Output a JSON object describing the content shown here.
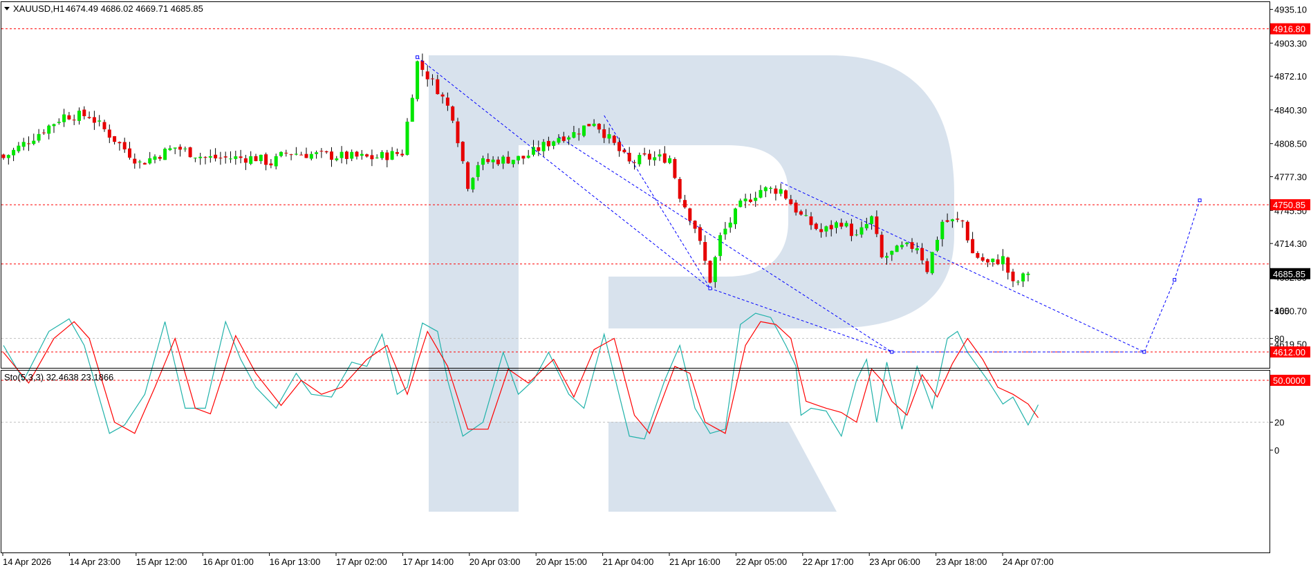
{
  "header": {
    "symbol_label": "XAUUSD,H1",
    "ohlc_label": "4674.49 4686.02 4669.71 4685.85"
  },
  "indicator": {
    "label": "Sto(5,3,3) 32.4638 23.1866",
    "main_color": "#20b2aa",
    "signal_color": "#ff0000"
  },
  "colors": {
    "bull": "#00e600",
    "bear": "#e60000",
    "level_line": "#ff0000",
    "forecast_line": "#0000ff",
    "watermark": "#d6e0ec"
  },
  "chart_data": [
    {
      "type": "candlestick",
      "symbol": "XAUUSD",
      "timeframe": "H1",
      "ylim": [
        4597,
        4942
      ],
      "y_ticks": [
        4935.1,
        4903.3,
        4872.1,
        4840.3,
        4808.5,
        4777.3,
        4745.5,
        4714.3,
        4682.5,
        4650.7,
        4619.5
      ],
      "y_tick_labels": [
        "4935.10",
        "4903.30",
        "4872.10",
        "4840.30",
        "4808.50",
        "4777.30",
        "4745.50",
        "4714.30",
        "4682.50",
        "4650.70",
        "4619.50"
      ],
      "x_labels": [
        "14 Apr 2026",
        "14 Apr 23:00",
        "15 Apr 12:00",
        "16 Apr 01:00",
        "16 Apr 13:00",
        "17 Apr 02:00",
        "17 Apr 14:00",
        "20 Apr 03:00",
        "20 Apr 15:00",
        "21 Apr 04:00",
        "21 Apr 16:00",
        "22 Apr 05:00",
        "22 Apr 17:00",
        "23 Apr 06:00",
        "23 Apr 18:00",
        "24 Apr 07:00"
      ],
      "levels": [
        {
          "value": 4916.8,
          "label": "4916.80"
        },
        {
          "value": 4750.85,
          "label": "4750.85"
        },
        {
          "value": 4695,
          "label": ""
        },
        {
          "value": 4612.0,
          "label": "4612.00"
        }
      ],
      "current_price": {
        "value": 4685.85,
        "label": "4685.85"
      },
      "key_closes": [
        {
          "bar": 0,
          "close": 4795
        },
        {
          "bar": 12,
          "close": 4835
        },
        {
          "bar": 17,
          "close": 4835
        },
        {
          "bar": 27,
          "close": 4790
        },
        {
          "bar": 34,
          "close": 4805
        },
        {
          "bar": 40,
          "close": 4795
        },
        {
          "bar": 50,
          "close": 4795
        },
        {
          "bar": 53,
          "close": 4790
        },
        {
          "bar": 56,
          "close": 4800
        },
        {
          "bar": 65,
          "close": 4797
        },
        {
          "bar": 73,
          "close": 4795
        },
        {
          "bar": 79,
          "close": 4800
        },
        {
          "bar": 82,
          "close": 4885
        },
        {
          "bar": 86,
          "close": 4860
        },
        {
          "bar": 89,
          "close": 4835
        },
        {
          "bar": 92,
          "close": 4770
        },
        {
          "bar": 94,
          "close": 4790
        },
        {
          "bar": 98,
          "close": 4793
        },
        {
          "bar": 103,
          "close": 4795
        },
        {
          "bar": 110,
          "close": 4815
        },
        {
          "bar": 113,
          "close": 4818
        },
        {
          "bar": 117,
          "close": 4830
        },
        {
          "bar": 124,
          "close": 4790
        },
        {
          "bar": 127,
          "close": 4795
        },
        {
          "bar": 132,
          "close": 4795
        },
        {
          "bar": 134,
          "close": 4760
        },
        {
          "bar": 137,
          "close": 4730
        },
        {
          "bar": 140,
          "close": 4680
        },
        {
          "bar": 142,
          "close": 4720
        },
        {
          "bar": 146,
          "close": 4750
        },
        {
          "bar": 150,
          "close": 4765
        },
        {
          "bar": 154,
          "close": 4765
        },
        {
          "bar": 158,
          "close": 4740
        },
        {
          "bar": 162,
          "close": 4725
        },
        {
          "bar": 166,
          "close": 4735
        },
        {
          "bar": 169,
          "close": 4720
        },
        {
          "bar": 172,
          "close": 4738
        },
        {
          "bar": 174,
          "close": 4700
        },
        {
          "bar": 178,
          "close": 4710
        },
        {
          "bar": 181,
          "close": 4712
        },
        {
          "bar": 183,
          "close": 4690
        },
        {
          "bar": 186,
          "close": 4735
        },
        {
          "bar": 190,
          "close": 4735
        },
        {
          "bar": 192,
          "close": 4705
        },
        {
          "bar": 195,
          "close": 4695
        },
        {
          "bar": 198,
          "close": 4700
        },
        {
          "bar": 200,
          "close": 4675
        },
        {
          "bar": 203,
          "close": 4685.85
        }
      ],
      "forecast_path": [
        {
          "bar": 82,
          "price": 4890
        },
        {
          "bar": 140,
          "price": 4672
        },
        {
          "bar": 176,
          "price": 4612
        },
        {
          "bar": 226,
          "price": 4612
        },
        {
          "bar": 232,
          "price": 4680
        },
        {
          "bar": 237,
          "price": 4755
        }
      ],
      "trend_lines": [
        {
          "from": {
            "bar": 110,
            "price": 4815
          },
          "to": {
            "bar": 176,
            "price": 4612
          }
        },
        {
          "from": {
            "bar": 119,
            "price": 4835
          },
          "to": {
            "bar": 140,
            "price": 4672
          }
        },
        {
          "from": {
            "bar": 154,
            "price": 4772
          },
          "to": {
            "bar": 226,
            "price": 4612
          }
        }
      ]
    },
    {
      "type": "line",
      "name": "Sto(5,3,3)",
      "ylim": [
        0,
        100
      ],
      "y_ticks": [
        100,
        80,
        20,
        0
      ],
      "y_tick_labels": [
        "100",
        "80",
        "20",
        "0"
      ],
      "levels": [
        {
          "value": 80,
          "label": ""
        },
        {
          "value": 50,
          "label": "50.0000"
        },
        {
          "value": 20,
          "label": ""
        }
      ],
      "series": [
        {
          "name": "main",
          "last": 32.4638,
          "key_points": [
            [
              0,
              75
            ],
            [
              4,
              50
            ],
            [
              9,
              85
            ],
            [
              13,
              94
            ],
            [
              16,
              75
            ],
            [
              21,
              12
            ],
            [
              24,
              18
            ],
            [
              28,
              40
            ],
            [
              32,
              92
            ],
            [
              36,
              30
            ],
            [
              40,
              30
            ],
            [
              44,
              92
            ],
            [
              47,
              65
            ],
            [
              50,
              45
            ],
            [
              54,
              30
            ],
            [
              58,
              55
            ],
            [
              61,
              40
            ],
            [
              65,
              38
            ],
            [
              69,
              63
            ],
            [
              72,
              60
            ],
            [
              75,
              83
            ],
            [
              78,
              40
            ],
            [
              80,
              45
            ],
            [
              83,
              91
            ],
            [
              86,
              85
            ],
            [
              88,
              50
            ],
            [
              91,
              10
            ],
            [
              95,
              20
            ],
            [
              99,
              70
            ],
            [
              102,
              40
            ],
            [
              105,
              50
            ],
            [
              108,
              70
            ],
            [
              112,
              40
            ],
            [
              115,
              30
            ],
            [
              119,
              83
            ],
            [
              124,
              10
            ],
            [
              127,
              8
            ],
            [
              131,
              50
            ],
            [
              134,
              75
            ],
            [
              137,
              30
            ],
            [
              140,
              12
            ],
            [
              143,
              15
            ],
            [
              146,
              90
            ],
            [
              149,
              98
            ],
            [
              152,
              95
            ],
            [
              155,
              75
            ],
            [
              157,
              60
            ],
            [
              158,
              25
            ],
            [
              160,
              30
            ],
            [
              163,
              28
            ],
            [
              166,
              10
            ],
            [
              169,
              50
            ],
            [
              171,
              65
            ],
            [
              173,
              20
            ],
            [
              175,
              63
            ],
            [
              178,
              15
            ],
            [
              181,
              60
            ],
            [
              184,
              30
            ],
            [
              187,
              80
            ],
            [
              189,
              85
            ],
            [
              191,
              70
            ],
            [
              195,
              50
            ],
            [
              198,
              33
            ],
            [
              200,
              38
            ],
            [
              203,
              18
            ],
            [
              205,
              32.4638
            ]
          ]
        },
        {
          "name": "signal",
          "last": 23.1866,
          "key_points": [
            [
              0,
              70
            ],
            [
              5,
              48
            ],
            [
              10,
              80
            ],
            [
              14,
              92
            ],
            [
              17,
              80
            ],
            [
              22,
              20
            ],
            [
              26,
              12
            ],
            [
              30,
              45
            ],
            [
              34,
              80
            ],
            [
              38,
              30
            ],
            [
              41,
              26
            ],
            [
              46,
              82
            ],
            [
              50,
              55
            ],
            [
              55,
              32
            ],
            [
              59,
              50
            ],
            [
              63,
              40
            ],
            [
              67,
              45
            ],
            [
              72,
              65
            ],
            [
              76,
              75
            ],
            [
              80,
              40
            ],
            [
              84,
              85
            ],
            [
              88,
              60
            ],
            [
              92,
              15
            ],
            [
              96,
              15
            ],
            [
              100,
              58
            ],
            [
              104,
              48
            ],
            [
              109,
              65
            ],
            [
              113,
              38
            ],
            [
              117,
              72
            ],
            [
              121,
              80
            ],
            [
              125,
              25
            ],
            [
              128,
              12
            ],
            [
              133,
              60
            ],
            [
              136,
              55
            ],
            [
              139,
              20
            ],
            [
              143,
              12
            ],
            [
              147,
              75
            ],
            [
              150,
              92
            ],
            [
              153,
              90
            ],
            [
              156,
              80
            ],
            [
              159,
              35
            ],
            [
              163,
              30
            ],
            [
              166,
              27
            ],
            [
              169,
              20
            ],
            [
              172,
              58
            ],
            [
              174,
              50
            ],
            [
              176,
              35
            ],
            [
              179,
              25
            ],
            [
              182,
              54
            ],
            [
              185,
              38
            ],
            [
              188,
              62
            ],
            [
              191,
              80
            ],
            [
              194,
              65
            ],
            [
              197,
              45
            ],
            [
              200,
              40
            ],
            [
              203,
              33
            ],
            [
              205,
              23.1866
            ]
          ]
        }
      ]
    }
  ]
}
